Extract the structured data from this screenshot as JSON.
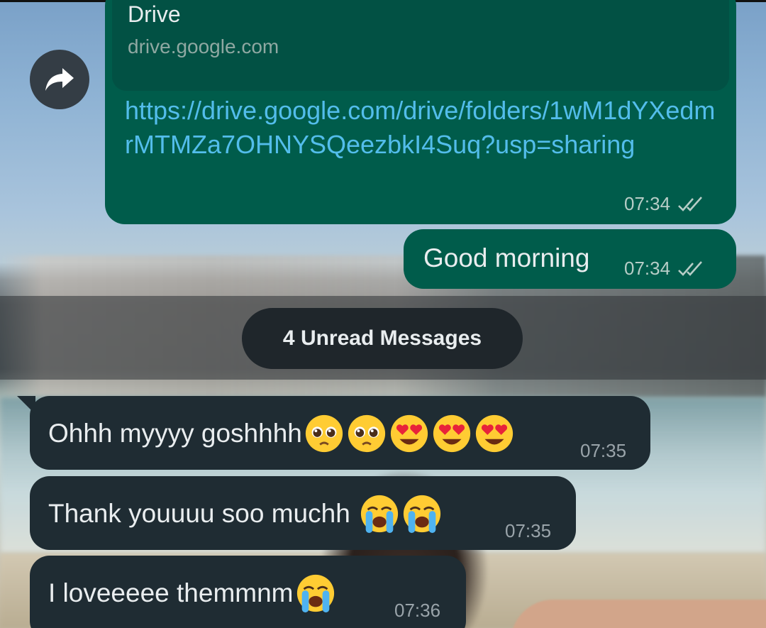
{
  "link_message": {
    "preview_title": "Drive",
    "preview_domain": "drive.google.com",
    "url": "https://drive.google.com/drive/folders/1wM1dYXedmrMTMZa7OHNYSQeezbkI4Suq?usp=sharing",
    "time": "07:34",
    "status": "read"
  },
  "text_message": {
    "text": "Good morning",
    "time": "07:34",
    "status": "read"
  },
  "unread_divider": {
    "label": "4 Unread Messages"
  },
  "incoming": [
    {
      "text": "Ohhh myyyy goshhhh",
      "emojis": [
        "pleading-face-emoji",
        "pleading-face-emoji",
        "heart-eyes-emoji",
        "heart-eyes-emoji",
        "heart-eyes-emoji"
      ],
      "time": "07:35"
    },
    {
      "text": "Thank youuuu soo muchh ",
      "emojis": [
        "loudly-crying-emoji",
        "loudly-crying-emoji"
      ],
      "time": "07:35"
    },
    {
      "text": "I loveeeee themmnm",
      "emojis": [
        "loudly-crying-emoji"
      ],
      "time": "07:36"
    }
  ],
  "colors": {
    "outgoing_bubble": "#005c4b",
    "incoming_bubble": "#1f2c33",
    "link": "#53bdeb",
    "unread_pill": "#1f262b"
  }
}
